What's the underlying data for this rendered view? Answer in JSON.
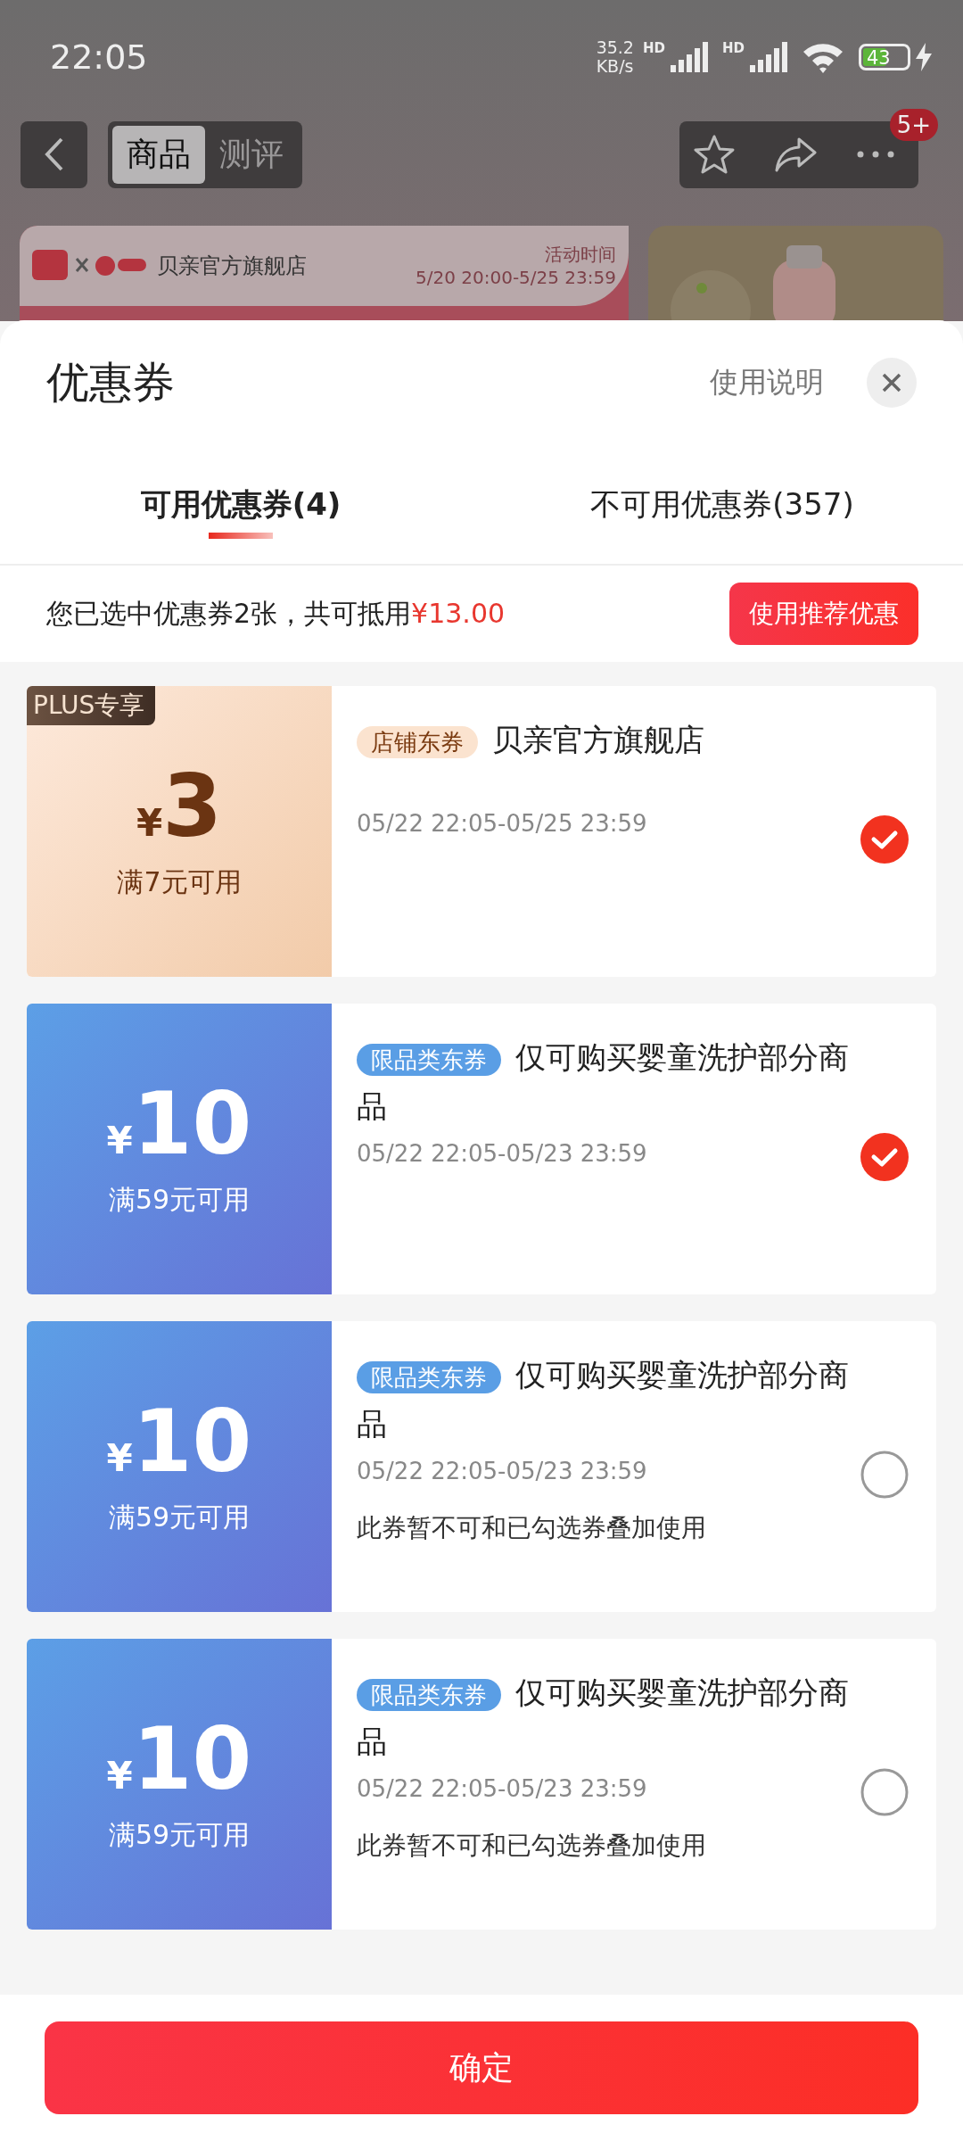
{
  "status_bar": {
    "time": "22:05",
    "net_speed": "35.2",
    "net_unit": "KB/s",
    "sim_labels": [
      "HD",
      "HD"
    ],
    "battery": "43"
  },
  "nav": {
    "tabs": [
      {
        "label": "商品",
        "selected": true
      },
      {
        "label": "测评",
        "selected": false
      }
    ],
    "badge": "5+"
  },
  "banner": {
    "brand": "贝亲官方旗舰店",
    "event_label": "活动时间",
    "event_time": "5/20 20:00-5/25 23:59"
  },
  "sheet": {
    "title": "优惠券",
    "help": "使用说明",
    "tabs": [
      {
        "label": "可用优惠券(4)",
        "selected": true
      },
      {
        "label": "不可用优惠券(357)",
        "selected": false
      }
    ],
    "summary": "您已选中优惠券2张，共可抵用",
    "summary_amount": "¥13.00",
    "recommend_button": "使用推荐优惠",
    "coupons": [
      {
        "kind": "plus",
        "badge": "PLUS专享",
        "currency": "¥",
        "amount": "3",
        "condition": "满7元可用",
        "tag": "店铺东券",
        "title": "贝亲官方旗舰店",
        "validity": "05/22 22:05-05/25 23:59",
        "selected": true
      },
      {
        "kind": "category",
        "currency": "¥",
        "amount": "10",
        "condition": "满59元可用",
        "tag": "限品类东券",
        "title": "仅可购买婴童洗护部分商品",
        "validity": "05/22 22:05-05/23 23:59",
        "selected": true
      },
      {
        "kind": "category",
        "currency": "¥",
        "amount": "10",
        "condition": "满59元可用",
        "tag": "限品类东券",
        "title": "仅可购买婴童洗护部分商品",
        "validity": "05/22 22:05-05/23 23:59",
        "note": "此券暂不可和已勾选券叠加使用",
        "selected": false
      },
      {
        "kind": "category",
        "currency": "¥",
        "amount": "10",
        "condition": "满59元可用",
        "tag": "限品类东券",
        "title": "仅可购买婴童洗护部分商品",
        "validity": "05/22 22:05-05/23 23:59",
        "note": "此券暂不可和已勾选券叠加使用",
        "selected": false
      }
    ],
    "confirm_button": "确定"
  }
}
